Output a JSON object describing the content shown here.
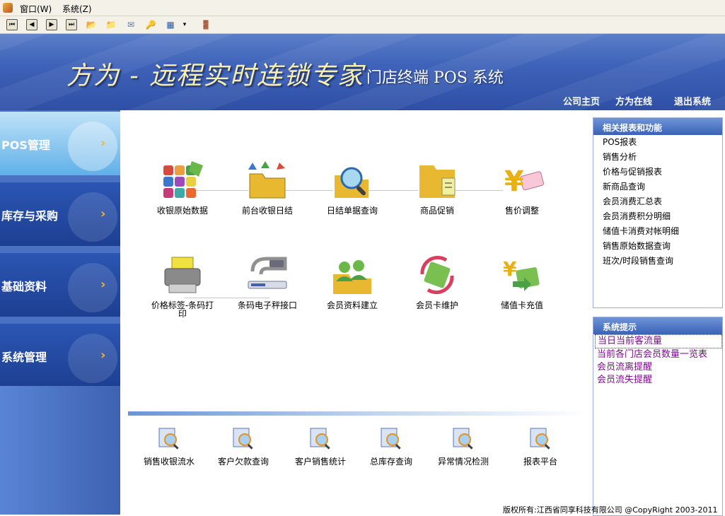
{
  "menubar": {
    "items": [
      "窗口(W)",
      "系统(Z)"
    ]
  },
  "toolbar": {
    "buttons": [
      "first-record-icon",
      "previous-record-icon",
      "next-record-icon",
      "last-record-icon",
      "open-folder-icon",
      "save-folder-icon",
      "mail-icon",
      "key-icon",
      "window-layout-icon",
      "dropdown-arrow-icon",
      "exit-door-icon"
    ]
  },
  "banner": {
    "brand": "方为 - 远程实时连锁专家",
    "system_title": "门店终端 POS 系统",
    "links": [
      "公司主页",
      "方为在线",
      "退出系统"
    ]
  },
  "sidebar": {
    "items": [
      {
        "label": "POS管理",
        "active": true
      },
      {
        "label": "库存与采购",
        "active": false
      },
      {
        "label": "基础资料",
        "active": false
      },
      {
        "label": "系统管理",
        "active": false
      }
    ]
  },
  "functions": {
    "row1": [
      {
        "label": "收银原始数据",
        "icon": "color-grid-icon"
      },
      {
        "label": "前台收银日结",
        "icon": "folder-arrows-icon"
      },
      {
        "label": "日结单据查询",
        "icon": "magnifier-icon"
      },
      {
        "label": "商品促销",
        "icon": "folder-documents-icon"
      },
      {
        "label": "售价调整",
        "icon": "yen-note-icon"
      }
    ],
    "row2": [
      {
        "label": "价格标签-条码打印",
        "icon": "printer-icon"
      },
      {
        "label": "条码电子秤接口",
        "icon": "scale-connector-icon"
      },
      {
        "label": "会员资料建立",
        "icon": "member-group-icon"
      },
      {
        "label": "会员卡维护",
        "icon": "card-refresh-icon"
      },
      {
        "label": "储值卡充值",
        "icon": "card-recharge-icon"
      }
    ]
  },
  "reports": [
    {
      "label": "销售收银流水"
    },
    {
      "label": "客户欠款查询"
    },
    {
      "label": "客户销售统计"
    },
    {
      "label": "总库存查询"
    },
    {
      "label": "异常情况检测"
    },
    {
      "label": "报表平台"
    }
  ],
  "related": {
    "title": "相关报表和功能",
    "items": [
      "POS报表",
      "销售分析",
      "价格与促销报表",
      "新商品查询",
      "会员消费汇总表",
      "会员消费积分明细",
      "储值卡消费对帐明细",
      "销售原始数据查询",
      "班次/时段销售查询"
    ]
  },
  "system_tips": {
    "title": "系统提示",
    "items": [
      "当日当前客流量",
      "当前各门店会员数量一览表",
      "会员流离提醒",
      "会员流失提醒"
    ]
  },
  "footer": {
    "text": "版权所有:江西省同享科技有限公司 @CopyRight 2003-2011"
  },
  "colors": {
    "banner": "#3f63b8",
    "nav": "#1d3f92",
    "nav_active": "#5fb0e8",
    "arrow": "#f5b330",
    "tip_text": "#7a0f8a"
  }
}
